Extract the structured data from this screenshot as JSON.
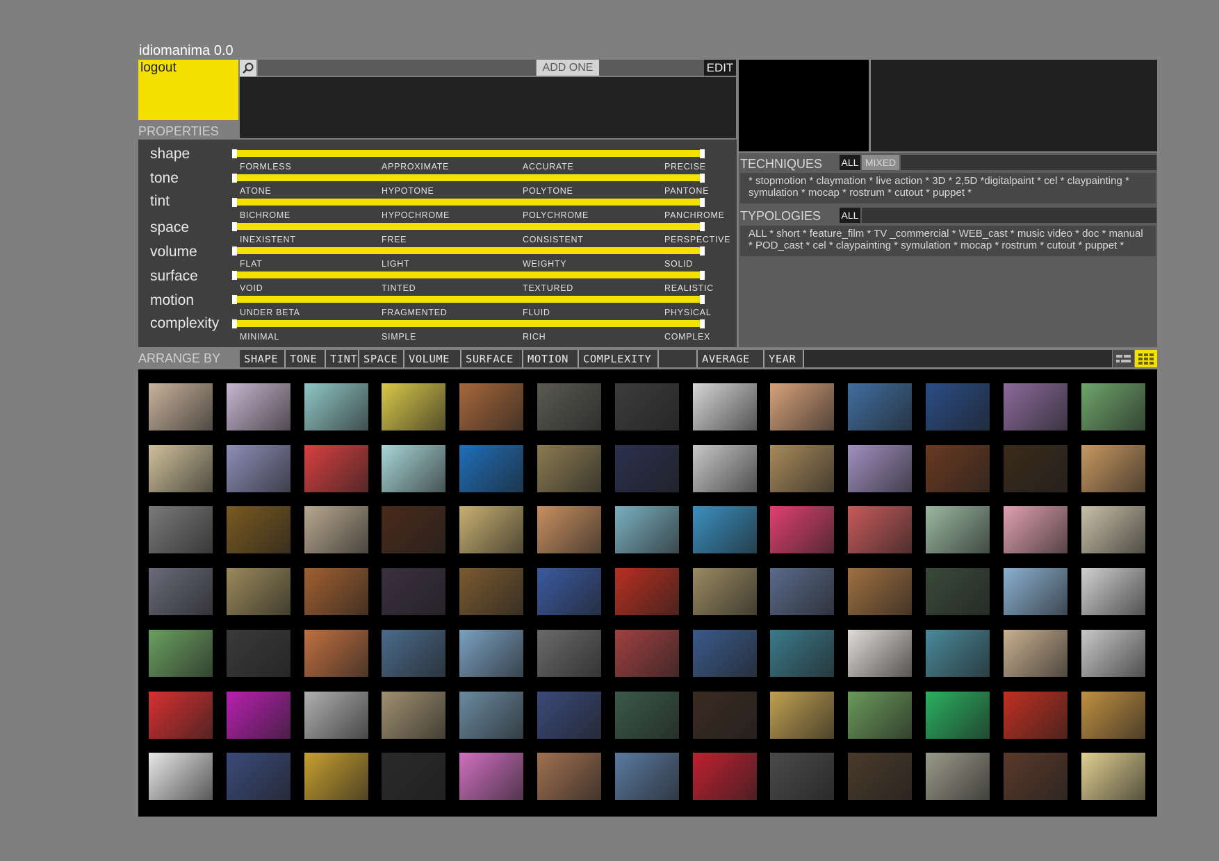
{
  "app": {
    "title": "idiomanima 0.0"
  },
  "user": {
    "logout_label": "logout"
  },
  "search": {
    "icon": "magnifier-icon",
    "add_label": "ADD ONE",
    "edit_label": "EDIT"
  },
  "properties": {
    "label": "PROPERTIES",
    "items": [
      {
        "name": "shape",
        "scale": [
          "FORMLESS",
          "APPROXIMATE",
          "ACCURATE",
          "PRECISE"
        ]
      },
      {
        "name": "tone",
        "scale": [
          "ATONE",
          "HYPOTONE",
          "POLYTONE",
          "PANTONE"
        ]
      },
      {
        "name": "tint",
        "scale": [
          "BICHROME",
          "HYPOCHROME",
          "POLYCHROME",
          "PANCHROME"
        ]
      },
      {
        "name": "space",
        "scale": [
          "INEXISTENT",
          "FREE",
          "CONSISTENT",
          "PERSPECTIVE"
        ]
      },
      {
        "name": "volume",
        "scale": [
          "FLAT",
          "LIGHT",
          "WEIGHTY",
          "SOLID"
        ]
      },
      {
        "name": "surface",
        "scale": [
          "VOID",
          "TINTED",
          "TEXTURED",
          "REALISTIC"
        ]
      },
      {
        "name": "motion",
        "scale": [
          "UNDER BETA",
          "FRAGMENTED",
          "FLUID",
          "PHYSICAL"
        ]
      },
      {
        "name": "complexity",
        "scale": [
          "MINIMAL",
          "SIMPLE",
          "RICH",
          "COMPLEX"
        ]
      }
    ]
  },
  "techniques": {
    "label": "TECHNIQUES",
    "all_label": "ALL",
    "mixed_label": "MIXED",
    "text": "* stopmotion * claymation * live action * 3D * 2,5D  *digitalpaint * cel * claypainting * symulation * mocap * rostrum * cutout * puppet *"
  },
  "typologies": {
    "label": "TYPOLOGIES",
    "all_label": "ALL",
    "text": "ALL * short * feature_film * TV _commercial * WEB_cast * music video * doc * manual * POD_cast * cel * claypainting * symulation * mocap * rostrum * cutout * puppet *"
  },
  "arrange": {
    "label": "ARRANGE BY",
    "buttons": [
      "SHAPE",
      "TONE",
      "TINT",
      "SPACE",
      "VOLUME",
      "SURFACE",
      "MOTION",
      "COMPLEXITY",
      "",
      "AVERAGE",
      "YEAR"
    ]
  },
  "colors": {
    "accent": "#f4e100",
    "background": "#7f7f7f"
  },
  "grid": {
    "rows": 7,
    "cols": 13,
    "thumbnails": [
      [
        "#c9b39c",
        "#c8b6d0",
        "#8fc7c6",
        "#d9c84a",
        "#a6673a",
        "#5a5a52",
        "#3c3c3c",
        "#d6d6d6",
        "#d7a27a",
        "#3f6ea0",
        "#2a4d86",
        "#8a6a9a",
        "#6ea56a"
      ],
      [
        "#d0c19a",
        "#8d8fb8",
        "#d84040",
        "#a8d6d8",
        "#1e6fb8",
        "#8a7a50",
        "#2a304e",
        "#c8c8c8",
        "#a88a5a",
        "#a090c0",
        "#6a3a20",
        "#3a2a1a",
        "#c89860"
      ],
      [
        "#7a7a7a",
        "#7a5a20",
        "#b8a890",
        "#4a2a1a",
        "#c8b070",
        "#c89060",
        "#7ab0c0",
        "#3a90c0",
        "#e04070",
        "#c85a5a",
        "#9ab8a0",
        "#e0a0b0",
        "#c8c0a8"
      ],
      [
        "#6a6a7a",
        "#9a8a5a",
        "#a06030",
        "#3a3040",
        "#7a5a30",
        "#3a5aa0",
        "#b83020",
        "#9a8a60",
        "#5a6a8a",
        "#a07040",
        "#3a4a3a",
        "#8ab0d0",
        "#d0d0d0"
      ],
      [
        "#6aa060",
        "#3a3a3a",
        "#c07040",
        "#4a6a8a",
        "#7aa0c0",
        "#6a6a6a",
        "#a04040",
        "#3a5a8a",
        "#3a7a8a",
        "#e0dcd8",
        "#4a8a9a",
        "#c8b090",
        "#c8c8c8"
      ],
      [
        "#d83030",
        "#b820b0",
        "#b0b0b0",
        "#a09070",
        "#6a8aa0",
        "#3a4a7a",
        "#3a5a4a",
        "#3a2a20",
        "#c0a050",
        "#6a9a5a",
        "#2ab060",
        "#c03020",
        "#c09040"
      ],
      [
        "#e8e8e8",
        "#3a4a7a",
        "#c8a030",
        "#2a2a2a",
        "#d070c0",
        "#a07050",
        "#5a7aa0",
        "#c02030",
        "#4a4a4a",
        "#4a3a2a",
        "#9a9a8a",
        "#5a3a2a",
        "#e0d090"
      ]
    ]
  }
}
